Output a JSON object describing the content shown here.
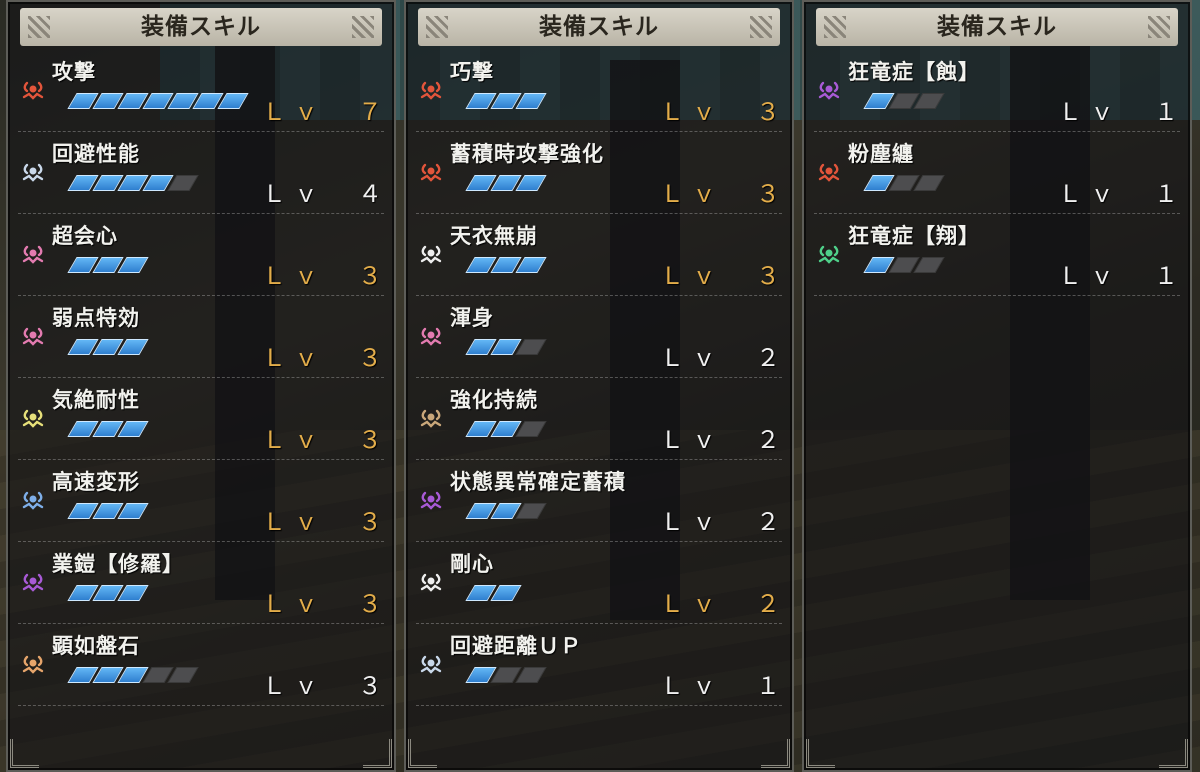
{
  "colors": {
    "pip_on": "#3f93e0",
    "pip_off": "#4d4d4f",
    "level_max": "#e3ad4a",
    "level_normal": "#f0f0f0"
  },
  "panels": [
    {
      "title": "装備スキル",
      "skills": [
        {
          "name": "攻撃",
          "level_label": "Ｌｖ　７",
          "level": 7,
          "max": 7,
          "is_max": true,
          "icon": "skill-icon-red",
          "icon_color": "#e2553b"
        },
        {
          "name": "回避性能",
          "level_label": "Ｌｖ　４",
          "level": 4,
          "max": 5,
          "is_max": false,
          "icon": "skill-icon-white",
          "icon_color": "#c9d8ea"
        },
        {
          "name": "超会心",
          "level_label": "Ｌｖ　３",
          "level": 3,
          "max": 3,
          "is_max": true,
          "icon": "skill-icon-pink",
          "icon_color": "#e37bb0"
        },
        {
          "name": "弱点特効",
          "level_label": "Ｌｖ　３",
          "level": 3,
          "max": 3,
          "is_max": true,
          "icon": "skill-icon-pink",
          "icon_color": "#e37bb0"
        },
        {
          "name": "気絶耐性",
          "level_label": "Ｌｖ　３",
          "level": 3,
          "max": 3,
          "is_max": true,
          "icon": "skill-icon-yellow",
          "icon_color": "#e6e07a"
        },
        {
          "name": "高速変形",
          "level_label": "Ｌｖ　３",
          "level": 3,
          "max": 3,
          "is_max": true,
          "icon": "skill-icon-blue",
          "icon_color": "#7eaee8"
        },
        {
          "name": "業鎧【修羅】",
          "level_label": "Ｌｖ　３",
          "level": 3,
          "max": 3,
          "is_max": true,
          "icon": "skill-icon-purple",
          "icon_color": "#a85ad6"
        },
        {
          "name": "顕如盤石",
          "level_label": "Ｌｖ　３",
          "level": 3,
          "max": 5,
          "is_max": false,
          "icon": "skill-icon-orange",
          "icon_color": "#e6a56b"
        }
      ]
    },
    {
      "title": "装備スキル",
      "skills": [
        {
          "name": "巧撃",
          "level_label": "Ｌｖ　３",
          "level": 3,
          "max": 3,
          "is_max": true,
          "icon": "skill-icon-red",
          "icon_color": "#e2553b"
        },
        {
          "name": "蓄積時攻撃強化",
          "level_label": "Ｌｖ　３",
          "level": 3,
          "max": 3,
          "is_max": true,
          "icon": "skill-icon-red",
          "icon_color": "#e2553b"
        },
        {
          "name": "天衣無崩",
          "level_label": "Ｌｖ　３",
          "level": 3,
          "max": 3,
          "is_max": true,
          "icon": "skill-icon-white",
          "icon_color": "#eeeeee"
        },
        {
          "name": "渾身",
          "level_label": "Ｌｖ　２",
          "level": 2,
          "max": 3,
          "is_max": false,
          "icon": "skill-icon-pink",
          "icon_color": "#e37bb0"
        },
        {
          "name": "強化持続",
          "level_label": "Ｌｖ　２",
          "level": 2,
          "max": 3,
          "is_max": false,
          "icon": "skill-icon-tan",
          "icon_color": "#c9a77a"
        },
        {
          "name": "状態異常確定蓄積",
          "level_label": "Ｌｖ　２",
          "level": 2,
          "max": 3,
          "is_max": false,
          "icon": "skill-icon-purple",
          "icon_color": "#a85ad6"
        },
        {
          "name": "剛心",
          "level_label": "Ｌｖ　２",
          "level": 2,
          "max": 2,
          "is_max": true,
          "icon": "skill-icon-white",
          "icon_color": "#eeeeee"
        },
        {
          "name": "回避距離ＵＰ",
          "level_label": "Ｌｖ　１",
          "level": 1,
          "max": 3,
          "is_max": false,
          "icon": "skill-icon-white",
          "icon_color": "#c9d8ea"
        }
      ]
    },
    {
      "title": "装備スキル",
      "skills": [
        {
          "name": "狂竜症【蝕】",
          "level_label": "Ｌｖ　１",
          "level": 1,
          "max": 3,
          "is_max": false,
          "icon": "skill-icon-purple",
          "icon_color": "#a85ad6"
        },
        {
          "name": "粉塵纏",
          "level_label": "Ｌｖ　１",
          "level": 1,
          "max": 3,
          "is_max": false,
          "icon": "skill-icon-red",
          "icon_color": "#e2553b"
        },
        {
          "name": "狂竜症【翔】",
          "level_label": "Ｌｖ　１",
          "level": 1,
          "max": 3,
          "is_max": false,
          "icon": "skill-icon-green",
          "icon_color": "#4fd18a"
        }
      ]
    }
  ]
}
